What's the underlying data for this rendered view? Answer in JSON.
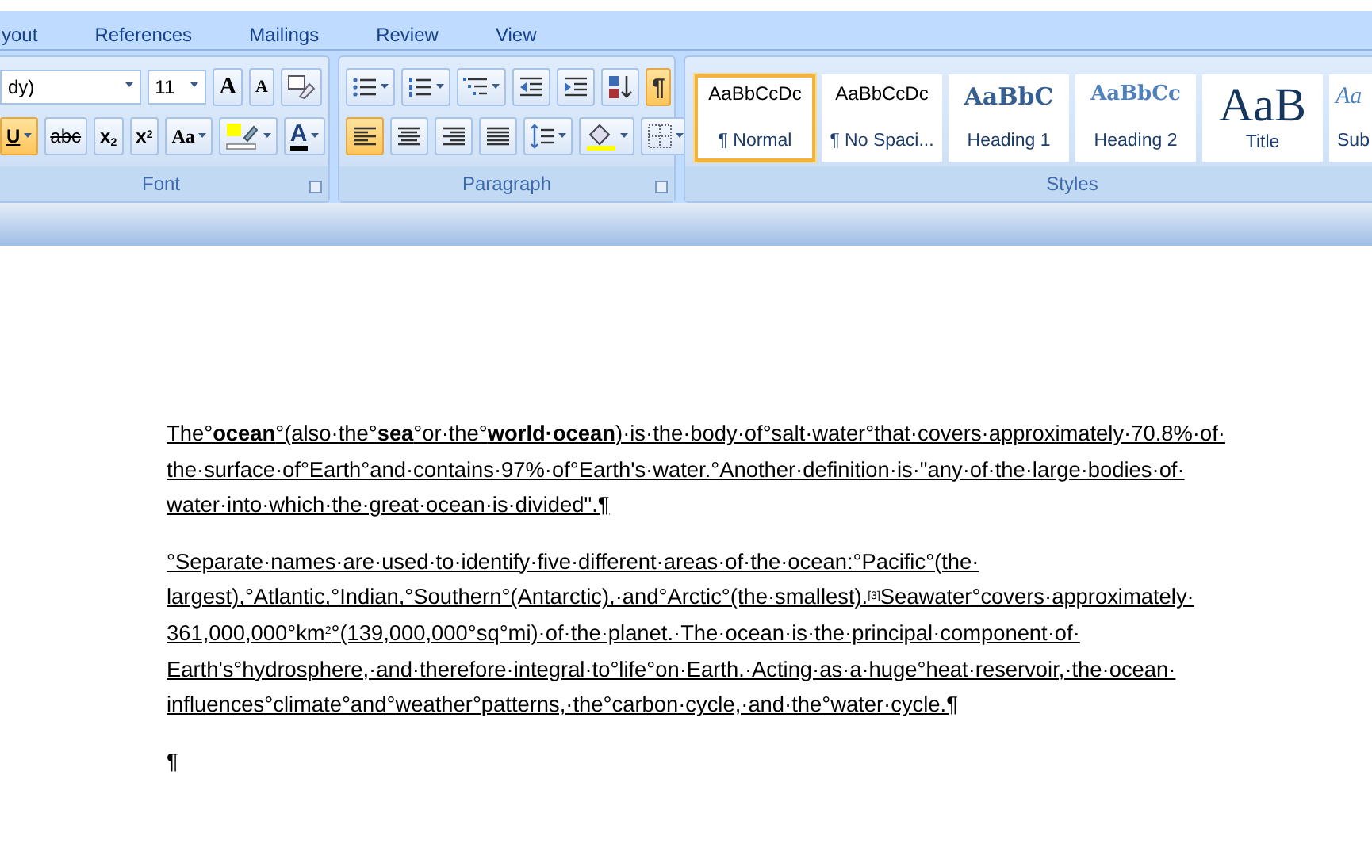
{
  "ribbon_tabs": [
    {
      "label": "yout",
      "selected": false
    },
    {
      "label": "References",
      "selected": false
    },
    {
      "label": "Mailings",
      "selected": false
    },
    {
      "label": "Review",
      "selected": false
    },
    {
      "label": "View",
      "selected": false
    }
  ],
  "font_group": {
    "label": "Font",
    "font_name": "dy)",
    "font_size": "11",
    "row1": [
      {
        "kind": "grow",
        "label": "A",
        "selected": false
      },
      {
        "kind": "shrink",
        "label": "A",
        "selected": false
      },
      {
        "kind": "clear",
        "selected": false
      }
    ],
    "row2": [
      {
        "kind": "underline",
        "label": "U",
        "selected": true,
        "dropdown": true
      },
      {
        "kind": "strike",
        "label": "abc",
        "selected": false
      },
      {
        "kind": "subscript",
        "label": "x$_{2}$",
        "selected": false
      },
      {
        "kind": "superscript",
        "label": "x$^{2}$",
        "selected": false
      },
      {
        "kind": "case",
        "label": "Aa",
        "selected": false,
        "dropdown": true
      },
      {
        "kind": "highlight",
        "selected": false,
        "dropdown": true
      },
      {
        "kind": "fontcolor",
        "label": "A",
        "selected": false,
        "dropdown": true
      }
    ]
  },
  "paragraph_group": {
    "label": "Paragraph",
    "row1": [
      {
        "kind": "bullets",
        "selected": false,
        "dropdown": true
      },
      {
        "kind": "numbering",
        "selected": false,
        "dropdown": true
      },
      {
        "kind": "multilevel",
        "selected": false,
        "dropdown": true
      },
      {
        "kind": "outdent",
        "selected": false
      },
      {
        "kind": "indent",
        "selected": false
      },
      {
        "kind": "sort",
        "selected": false
      },
      {
        "kind": "marks",
        "label": "¶",
        "selected": true
      }
    ],
    "row2": [
      {
        "kind": "left",
        "selected": true
      },
      {
        "kind": "center",
        "selected": false
      },
      {
        "kind": "right",
        "selected": false
      },
      {
        "kind": "justify",
        "selected": false
      },
      {
        "kind": "spacing",
        "selected": false,
        "dropdown": true
      },
      {
        "kind": "shading",
        "selected": false,
        "dropdown": true
      },
      {
        "kind": "borders",
        "selected": false,
        "dropdown": true
      }
    ]
  },
  "styles_group": {
    "label": "Styles",
    "items": [
      {
        "kind": "normal",
        "preview": "AaBbCcDc",
        "name": "¶ Normal",
        "selected": true
      },
      {
        "kind": "nospacing",
        "preview": "AaBbCcDc",
        "name": "¶ No Spaci...",
        "selected": false
      },
      {
        "kind": "heading1",
        "preview": "AaBbC",
        "name": "Heading 1",
        "selected": false
      },
      {
        "kind": "heading2",
        "preview": "AaBbCc",
        "name": "Heading 2",
        "selected": false
      },
      {
        "kind": "title",
        "preview": "AaB",
        "name": "Title",
        "selected": false
      },
      {
        "kind": "subtitle",
        "preview": "Aa",
        "name": "Sub",
        "selected": false
      }
    ]
  },
  "document": {
    "paragraphs": [
      {
        "lines": [
          "The°**ocean**°(also·the°**sea**°or·the°**world·ocean**)·is·the·body·of°salt·water°that·covers·approximately·70.8%·of·",
          "the·surface·of°Earth°and·contains·97%·of°Earth's·water.°Another·definition·is·\"any·of·the·large·bodies·of·",
          "water·into·which·the·great·ocean·is·divided\".¶"
        ]
      },
      {
        "lines": [
          "°Separate·names·are·used·to·identify·five·different·areas·of·the·ocean:°Pacific°(the·",
          "largest),°Atlantic,°Indian,°Southern°(Antarctic),·and°Arctic°(the·smallest).$^{[3]}$Seawater°covers·approximately·",
          "361,000,000°km$^{2}$°(139,000,000°sq°mi)·of·the·planet.·The·ocean·is·the·principal·component·of·",
          "Earth's°hydrosphere,·and·therefore·integral·to°life°on·Earth.·Acting·as·a·huge°heat·reservoir,·the·ocean·",
          "influences°climate°and°weather°patterns,·the°carbon·cycle,·and·the°water·cycle.¶"
        ]
      },
      {
        "lines": [
          "¶"
        ]
      }
    ]
  }
}
